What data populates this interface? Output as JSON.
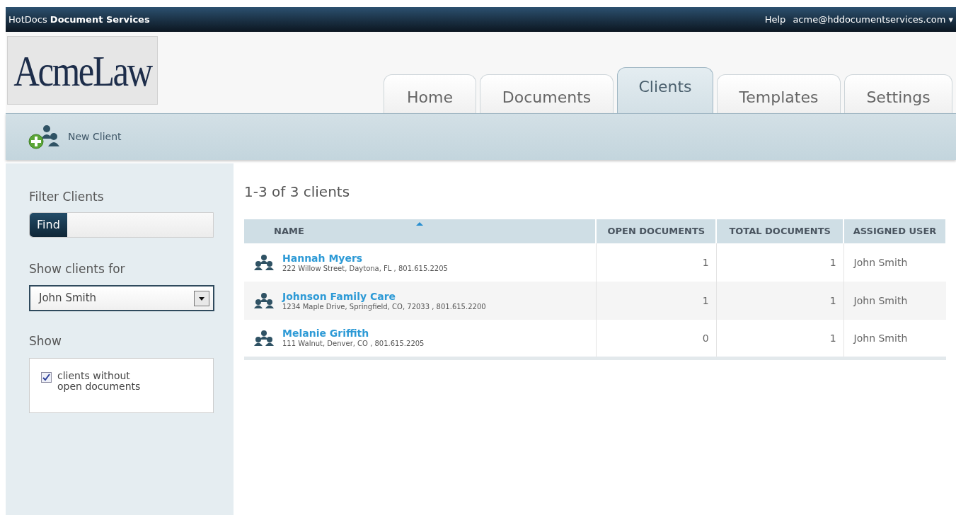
{
  "top_bar": {
    "brand": "HotDocs **Document Services**",
    "help": "Help",
    "account": "acme@hddocumentservices.com",
    "account_menu": "▾"
  },
  "logo": "AcmeLaw",
  "tabs": [
    {
      "label": "Home",
      "selected": false
    },
    {
      "label": "Documents",
      "selected": false
    },
    {
      "label": "Clients",
      "selected": true
    },
    {
      "label": "Templates",
      "selected": false
    },
    {
      "label": "Settings",
      "selected": false
    }
  ],
  "toolbar": {
    "new_client": "New Client"
  },
  "sidebar": {
    "filter_title": "Filter Clients",
    "find_label": "Find",
    "show_for_label": "Show clients for",
    "show_for_value": "John Smith",
    "show_label": "Show",
    "options": [
      {
        "label": "clients without open documents",
        "checked": true
      }
    ]
  },
  "results": {
    "summary": "1-3 of 3 clients"
  },
  "table": {
    "columns": [
      {
        "label": "NAME",
        "sorted": true
      },
      {
        "label": "OPEN DOCUMENTS",
        "sorted": false
      },
      {
        "label": "TOTAL DOCUMENTS",
        "sorted": false
      },
      {
        "label": "ASSIGNED USER",
        "sorted": false
      }
    ],
    "rows": [
      {
        "name": "Hannah Myers",
        "address": "222 Willow Street, Daytona, FL , 801.615.2205",
        "open": "1",
        "total": "1",
        "user": "John Smith"
      },
      {
        "name": "Johnson Family Care",
        "address": "1234 Maple Drive, Springfield, CO, 72033 , 801.615.2200",
        "open": "1",
        "total": "1",
        "user": "John Smith"
      },
      {
        "name": "Melanie Griffith",
        "address": "111 Walnut, Denver, CO , 801.615.2205",
        "open": "0",
        "total": "1",
        "user": "John Smith"
      }
    ]
  }
}
